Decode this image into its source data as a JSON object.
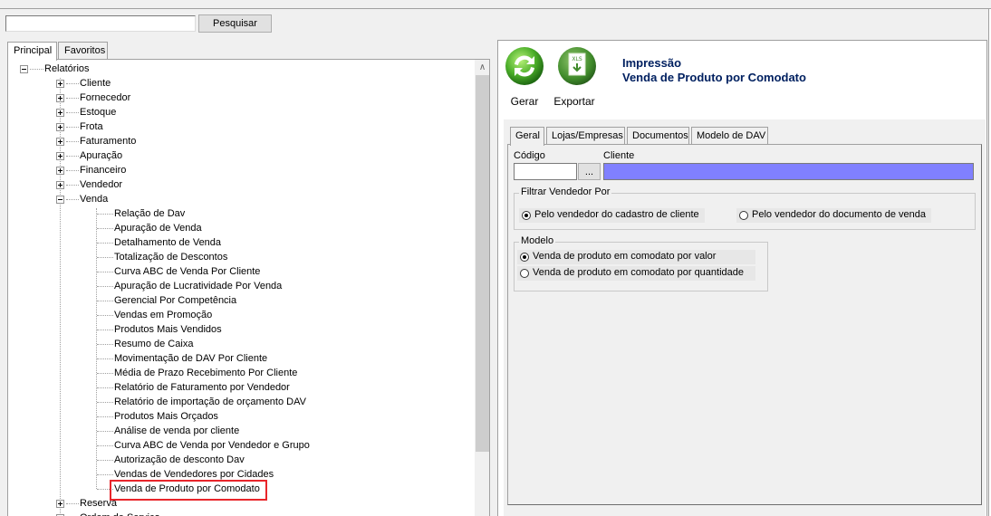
{
  "search": {
    "value": "",
    "button_label": "Pesquisar"
  },
  "left_tabs": [
    "Principal",
    "Favoritos"
  ],
  "tree": {
    "root": "Relatórios",
    "groups": [
      "Cliente",
      "Fornecedor",
      "Estoque",
      "Frota",
      "Faturamento",
      "Apuração",
      "Financeiro",
      "Vendedor",
      "Venda"
    ],
    "venda_items": [
      "Relação de Dav",
      "Apuração de Venda",
      "Detalhamento de Venda",
      "Totalização de Descontos",
      "Curva ABC de Venda Por Cliente",
      "Apuração de Lucratividade Por Venda",
      "Gerencial Por Competência",
      "Vendas em Promoção",
      "Produtos Mais Vendidos",
      "Resumo de Caixa",
      "Movimentação de DAV Por Cliente",
      "Média de Prazo Recebimento Por Cliente",
      "Relatório de Faturamento por Vendedor",
      "Relatório de importação de orçamento DAV",
      "Produtos Mais Orçados",
      "Análise de venda por cliente",
      "Curva ABC de Venda por Vendedor e Grupo",
      "Autorização de desconto Dav",
      "Vendas de Vendedores por Cidades",
      "Venda de Produto por Comodato"
    ],
    "after_groups": [
      "Reserva",
      "Ordem de Serviço"
    ]
  },
  "toolbar": {
    "generate_label": "Gerar",
    "export_label": "Exportar",
    "export_badge": "XLS"
  },
  "header": {
    "line1": "Impressão",
    "line2": "Venda de Produto por Comodato"
  },
  "inner_tabs": [
    "Geral",
    "Lojas/Empresas",
    "Documentos",
    "Modelo de DAV"
  ],
  "form": {
    "code_label": "Código",
    "code_value": "",
    "lookup_label": "...",
    "client_label": "Cliente",
    "client_value": "",
    "client_color": "#8080ff",
    "filter_group": {
      "title": "Filtrar Vendedor Por",
      "options": [
        "Pelo vendedor do cadastro de cliente",
        "Pelo vendedor do documento de venda"
      ],
      "selected": 0
    },
    "model_group": {
      "title": "Modelo",
      "options": [
        "Venda de produto em comodato por valor",
        "Venda de produto em comodato por quantidade"
      ],
      "selected": 0
    }
  },
  "colors": {
    "header_text": "#002060",
    "highlight_border": "#e8252b"
  }
}
